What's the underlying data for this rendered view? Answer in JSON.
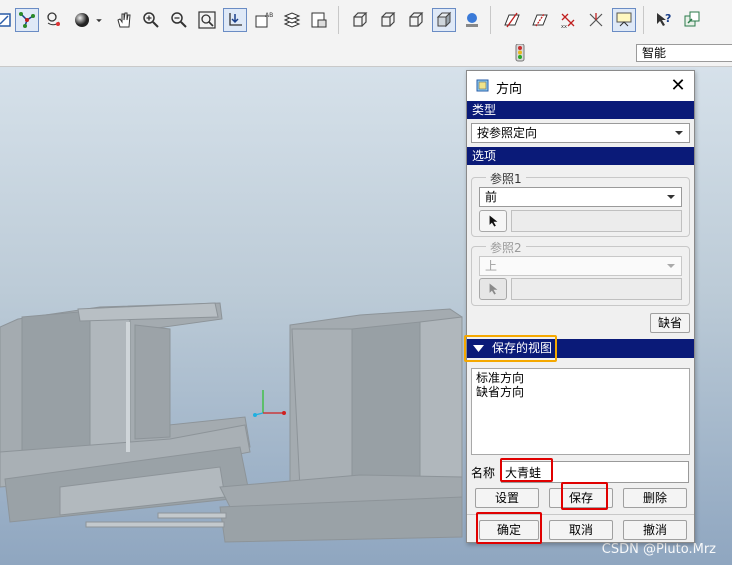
{
  "toolbar": {
    "buttons": [
      {
        "name": "view-normal-icon",
        "active": false
      },
      {
        "name": "spin-center-icon",
        "active": true
      },
      {
        "name": "pan-zoom-icon",
        "active": false
      },
      {
        "name": "sphere-appearance-icon",
        "active": false
      },
      {
        "name": "hand-pan-icon",
        "active": false
      },
      {
        "name": "zoom-in-icon",
        "active": false
      },
      {
        "name": "zoom-out-icon",
        "active": false
      },
      {
        "name": "refit-icon",
        "active": false
      },
      {
        "name": "orient-icon",
        "active": true
      },
      {
        "name": "saved-views-icon",
        "active": false
      },
      {
        "name": "layers-icon",
        "active": false
      },
      {
        "name": "display-style-icon",
        "active": false
      }
    ],
    "smart_filter": "智能"
  },
  "dialog": {
    "title": "方向",
    "close_glyph": "✕",
    "type_section": "类型",
    "type_value": "按参照定向",
    "options_section": "选项",
    "ref1": {
      "label": "参照1",
      "value": "前"
    },
    "ref2": {
      "label": "参照2",
      "value": "上"
    },
    "default_button": "缺省",
    "saved_views_section": "保存的视图",
    "saved_views": [
      "标准方向",
      "缺省方向"
    ],
    "name_label": "名称",
    "name_value": "大青蛙",
    "buttons": {
      "set": "设置",
      "save": "保存",
      "delete": "删除"
    },
    "footer": {
      "ok": "确定",
      "cancel": "取消",
      "revert": "撤消"
    }
  },
  "watermark": "CSDN @Pluto.Mrz",
  "colors": {
    "section_bg": "#0a1a78",
    "highlight_red": "#e00000",
    "highlight_orange": "#f5a800",
    "model_gray": "#a4abb0"
  }
}
